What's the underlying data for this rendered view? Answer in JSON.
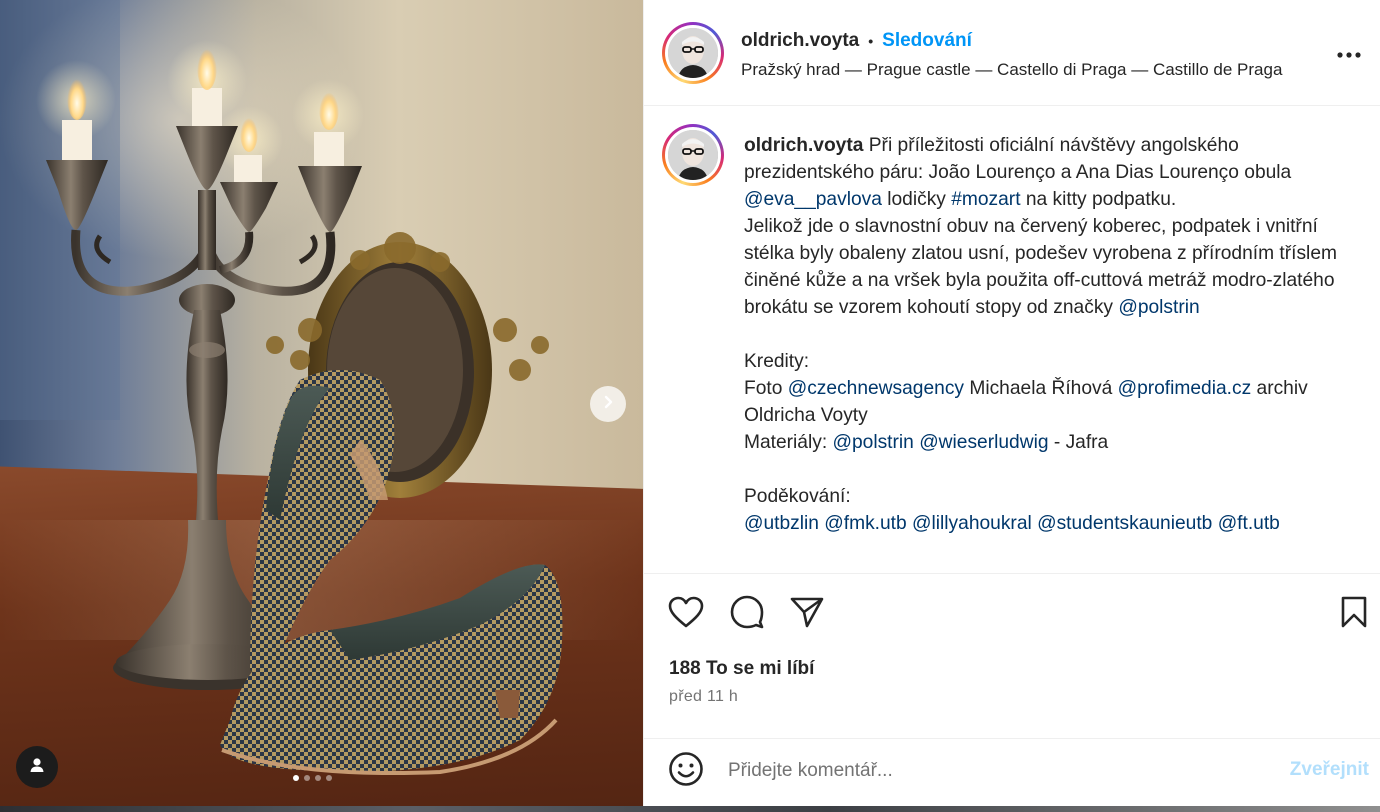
{
  "media": {
    "next_button_icon": "chevron-right-icon",
    "user_tags_icon": "person-icon",
    "carousel": {
      "total": 4,
      "active_index": 0
    }
  },
  "header": {
    "username": "oldrich.voyta",
    "separator": "•",
    "follow_label": "Sledování",
    "location": "Pražský hrad — Prague castle — Castello di Praga — Castillo de Praga",
    "more_icon": "more-horizontal-icon"
  },
  "caption": {
    "username": "oldrich.voyta",
    "segments": [
      {
        "text": " Při příležitosti oficiální návštěvy angolského prezidentského páru: João Lourenço a Ana Dias Lourenço obula ",
        "link": false
      },
      {
        "text": "@eva__pavlova",
        "link": true
      },
      {
        "text": " lodičky ",
        "link": false
      },
      {
        "text": "#mozart",
        "link": true
      },
      {
        "text": " na kitty podpatku.\nJelikož jde o slavnostní obuv na červený koberec, podpatek i vnitřní stélka byly obaleny zlatou usní, podešev vyrobena z přírodním tříslem činěné kůže a na vršek byla použita off-cuttová metráž modro-zlatého brokátu se vzorem kohoutí stopy od značky ",
        "link": false
      },
      {
        "text": "@polstrin",
        "link": true
      },
      {
        "text": "\n\nKredity:\nFoto ",
        "link": false
      },
      {
        "text": "@czechnewsagency",
        "link": true
      },
      {
        "text": " Michaela Říhová ",
        "link": false
      },
      {
        "text": "@profimedia.cz",
        "link": true
      },
      {
        "text": " archiv Oldricha Voyty\nMateriály: ",
        "link": false
      },
      {
        "text": "@polstrin",
        "link": true
      },
      {
        "text": " ",
        "link": false
      },
      {
        "text": "@wieserludwig",
        "link": true
      },
      {
        "text": " - Jafra\n\nPoděkování:\n",
        "link": false
      },
      {
        "text": "@utbzlin",
        "link": true
      },
      {
        "text": " ",
        "link": false
      },
      {
        "text": "@fmk.utb",
        "link": true
      },
      {
        "text": " ",
        "link": false
      },
      {
        "text": "@lillyahoukral",
        "link": true
      },
      {
        "text": " ",
        "link": false
      },
      {
        "text": "@studentskaunieutb",
        "link": true
      },
      {
        "text": " ",
        "link": false
      },
      {
        "text": "@ft.utb",
        "link": true
      }
    ]
  },
  "actions": {
    "like_icon": "heart-icon",
    "comment_icon": "comment-bubble-icon",
    "share_icon": "paper-plane-icon",
    "save_icon": "bookmark-icon",
    "likes_text": "188 To se mi líbí",
    "time_text": "před 11 h"
  },
  "comment": {
    "emoji_icon": "smiley-icon",
    "placeholder": "Přidejte komentář...",
    "post_label": "Zveřejnit"
  },
  "colors": {
    "accent": "#0095f6",
    "mention": "#00376b",
    "text": "#262626",
    "muted": "#737373",
    "post_disabled": "#b2dffc"
  }
}
